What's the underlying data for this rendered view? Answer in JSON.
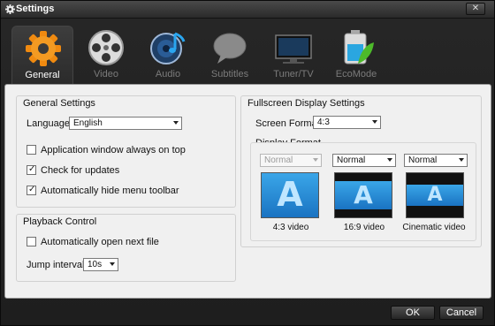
{
  "window": {
    "title": "Settings"
  },
  "colors": {
    "accent_orange": "#f08a10",
    "screen_blue": "#2e8fd8",
    "panel_bg": "#f0f0f0",
    "chrome_dark": "#222222"
  },
  "tabs": [
    {
      "label": "General",
      "icon": "gear-icon",
      "active": true
    },
    {
      "label": "Video",
      "icon": "film-reel-icon",
      "active": false
    },
    {
      "label": "Audio",
      "icon": "speaker-note-icon",
      "active": false
    },
    {
      "label": "Subtitles",
      "icon": "speech-bubble-icon",
      "active": false
    },
    {
      "label": "Tuner/TV",
      "icon": "tv-icon",
      "active": false
    },
    {
      "label": "EcoMode",
      "icon": "battery-leaf-icon",
      "active": false
    }
  ],
  "general_settings": {
    "legend": "General Settings",
    "language_label": "Language:",
    "language_value": "English",
    "checkboxes": [
      {
        "label": "Application window always on top",
        "checked": false
      },
      {
        "label": "Check for updates",
        "checked": true
      },
      {
        "label": "Automatically hide menu toolbar",
        "checked": true
      }
    ]
  },
  "playback_control": {
    "legend": "Playback Control",
    "auto_next_label": "Automatically open next file",
    "auto_next_checked": false,
    "jump_label": "Jump interval:",
    "jump_value": "10s"
  },
  "fullscreen": {
    "legend": "Fullscreen Display Settings",
    "screen_format_label": "Screen Format:",
    "screen_format_value": "4:3",
    "display_format_legend": "Display Format",
    "formats": [
      {
        "select": "Normal",
        "enabled": false,
        "caption": "4:3 video"
      },
      {
        "select": "Normal",
        "enabled": true,
        "caption": "16:9 video"
      },
      {
        "select": "Normal",
        "enabled": true,
        "caption": "Cinematic video"
      }
    ]
  },
  "buttons": {
    "ok": "OK",
    "cancel": "Cancel"
  }
}
